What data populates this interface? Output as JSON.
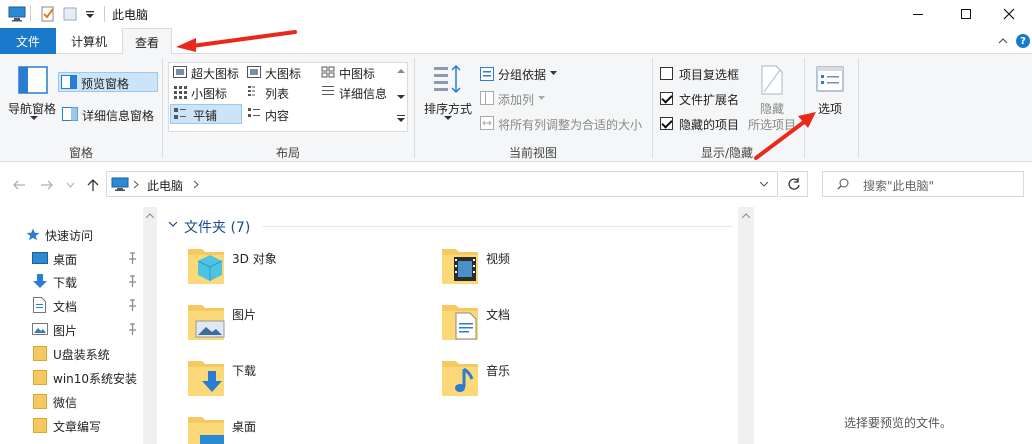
{
  "window": {
    "title": "此电脑"
  },
  "tabs": [
    {
      "label": "文件"
    },
    {
      "label": "计算机"
    },
    {
      "label": "查看"
    }
  ],
  "ribbon": {
    "pane": {
      "nav_pane": "导航窗格",
      "preview_pane": "预览窗格",
      "details_pane": "详细信息窗格",
      "group_label": "窗格"
    },
    "layout": {
      "items": [
        "超大图标",
        "大图标",
        "中图标",
        "小图标",
        "列表",
        "详细信息",
        "平铺",
        "内容"
      ],
      "selected": "平铺",
      "group_label": "布局"
    },
    "current_view": {
      "sort_by": "排序方式",
      "group_by": "分组依据",
      "add_column": "添加列",
      "fit_columns": "将所有列调整为合适的大小",
      "group_label": "当前视图"
    },
    "show_hide": {
      "item_checkbox": {
        "label": "项目复选框",
        "checked": false
      },
      "extensions": {
        "label": "文件扩展名",
        "checked": true
      },
      "hidden_items": {
        "label": "隐藏的项目",
        "checked": true
      },
      "hide_selected_line1": "隐藏",
      "hide_selected_line2": "所选项目",
      "group_label": "显示/隐藏"
    },
    "options": {
      "label": "选项"
    }
  },
  "address": {
    "crumb": "此电脑",
    "search_placeholder": "搜索\"此电脑\""
  },
  "nav": {
    "quick_access": "快速访问",
    "items": [
      {
        "label": "桌面",
        "pinned": true
      },
      {
        "label": "下载",
        "pinned": true
      },
      {
        "label": "文档",
        "pinned": true
      },
      {
        "label": "图片",
        "pinned": true
      },
      {
        "label": "U盘装系统",
        "pinned": false
      },
      {
        "label": "win10系统安装",
        "pinned": false
      },
      {
        "label": "微信",
        "pinned": false
      },
      {
        "label": "文章编写",
        "pinned": false
      }
    ]
  },
  "content": {
    "section_header": "文件夹 (7)",
    "folders": [
      {
        "label": "3D 对象",
        "icon": "3d-objects-icon"
      },
      {
        "label": "视频",
        "icon": "videos-icon"
      },
      {
        "label": "图片",
        "icon": "pictures-icon"
      },
      {
        "label": "文档",
        "icon": "documents-icon"
      },
      {
        "label": "下载",
        "icon": "downloads-icon"
      },
      {
        "label": "音乐",
        "icon": "music-icon"
      },
      {
        "label": "桌面",
        "icon": "desktop-icon"
      }
    ]
  },
  "preview": {
    "message": "选择要预览的文件。"
  },
  "colors": {
    "accent": "#1979ca",
    "annotation": "#e8291c",
    "folder": "#f5c95f"
  }
}
